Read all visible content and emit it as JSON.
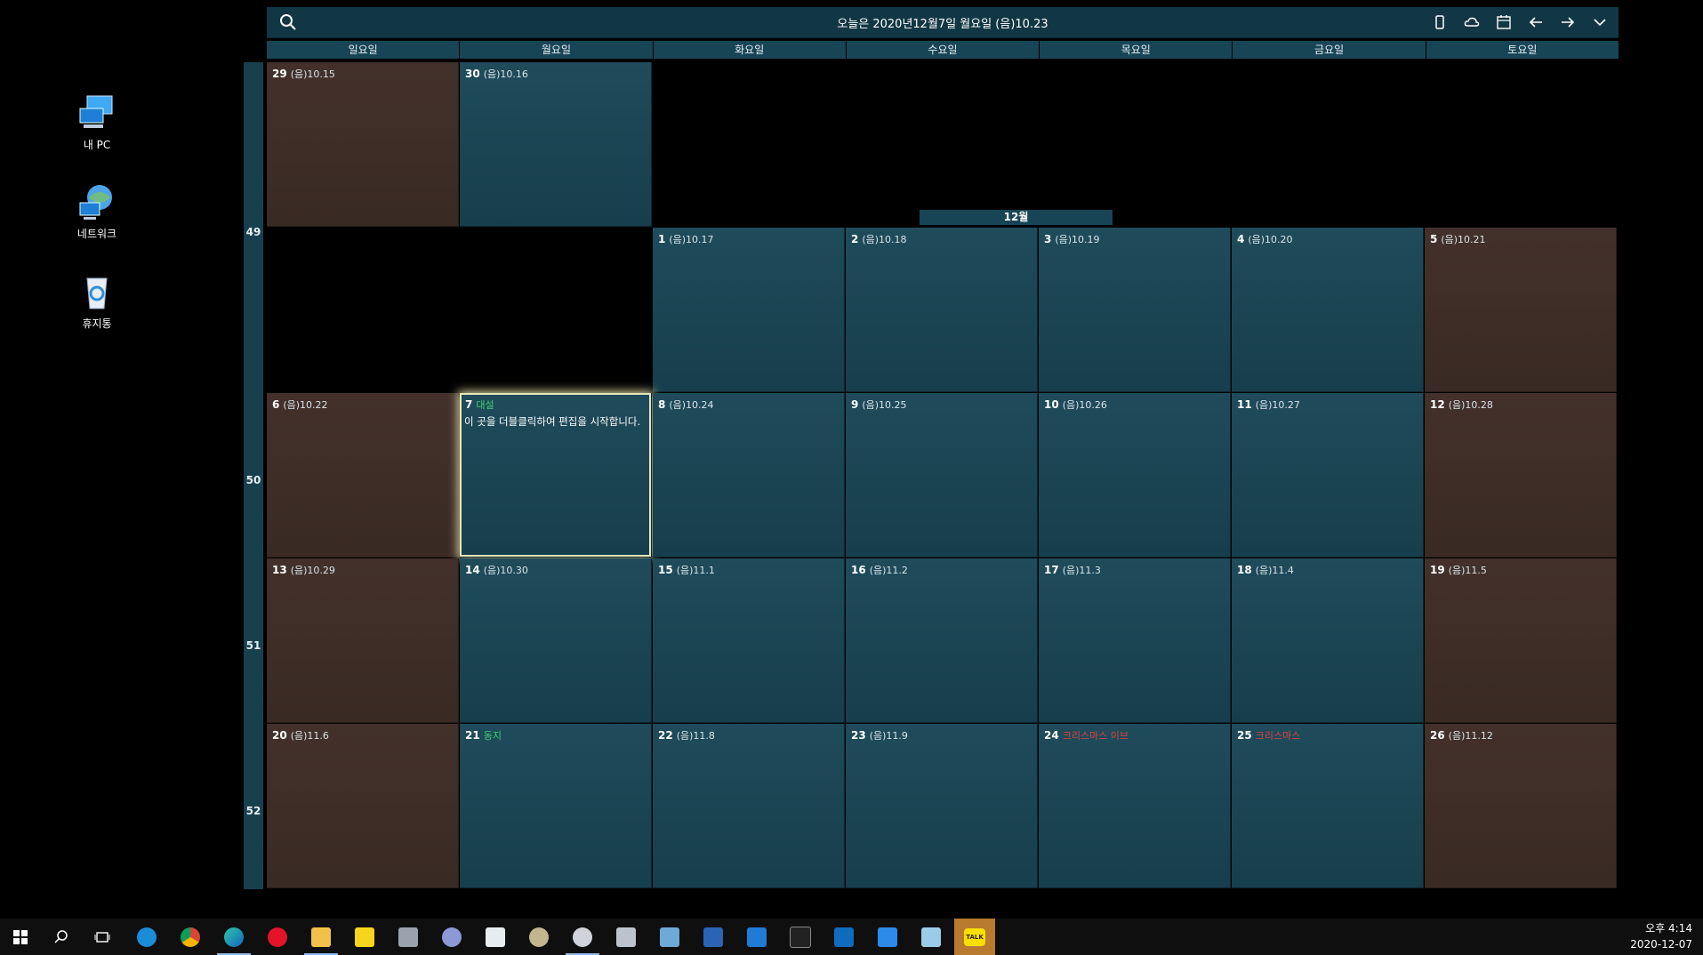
{
  "desktop": {
    "icons": [
      {
        "label": "내 PC",
        "icon": "computer-icon"
      },
      {
        "label": "네트워크",
        "icon": "network-icon"
      },
      {
        "label": "휴지통",
        "icon": "recycle-bin-icon"
      }
    ]
  },
  "calendar": {
    "title": "오늘은 2020년12월7일 월요일 (음)10.23",
    "day_names": [
      "일요일",
      "월요일",
      "화요일",
      "수요일",
      "목요일",
      "금요일",
      "토요일"
    ],
    "month_label": "12월",
    "week_numbers": [
      "49",
      "50",
      "51",
      "52"
    ],
    "prev_days": [
      {
        "num": "29",
        "lunar": "(음)10.15"
      },
      {
        "num": "30",
        "lunar": "(음)10.16"
      }
    ],
    "days": [
      {
        "num": "1",
        "lunar": "(음)10.17"
      },
      {
        "num": "2",
        "lunar": "(음)10.18"
      },
      {
        "num": "3",
        "lunar": "(음)10.19"
      },
      {
        "num": "4",
        "lunar": "(음)10.20"
      },
      {
        "num": "5",
        "lunar": "(음)10.21"
      },
      {
        "num": "6",
        "lunar": "(음)10.22"
      },
      {
        "num": "7",
        "lunar": "대설",
        "memo": "이 곳을 더블클릭하여 편집을 시작합니다."
      },
      {
        "num": "8",
        "lunar": "(음)10.24"
      },
      {
        "num": "9",
        "lunar": "(음)10.25"
      },
      {
        "num": "10",
        "lunar": "(음)10.26"
      },
      {
        "num": "11",
        "lunar": "(음)10.27"
      },
      {
        "num": "12",
        "lunar": "(음)10.28"
      },
      {
        "num": "13",
        "lunar": "(음)10.29"
      },
      {
        "num": "14",
        "lunar": "(음)10.30"
      },
      {
        "num": "15",
        "lunar": "(음)11.1"
      },
      {
        "num": "16",
        "lunar": "(음)11.2"
      },
      {
        "num": "17",
        "lunar": "(음)11.3"
      },
      {
        "num": "18",
        "lunar": "(음)11.4"
      },
      {
        "num": "19",
        "lunar": "(음)11.5"
      },
      {
        "num": "20",
        "lunar": "(음)11.6"
      },
      {
        "num": "21",
        "lunar": "동지"
      },
      {
        "num": "22",
        "lunar": "(음)11.8"
      },
      {
        "num": "23",
        "lunar": "(음)11.9"
      },
      {
        "num": "24",
        "lunar": "크리스마스 이브"
      },
      {
        "num": "25",
        "lunar": "크리스마스"
      },
      {
        "num": "26",
        "lunar": "(음)11.12"
      }
    ],
    "toolbar_icons": [
      "phone-icon",
      "cloud-icon",
      "calendar-icon",
      "arrow-left-icon",
      "arrow-right-icon",
      "chevron-down-icon"
    ],
    "colors": {
      "weekday": "#1f4b5b",
      "weekend": "#43302a",
      "solar_term": "#3fce6f",
      "holiday": "#e0423e"
    }
  },
  "taskbar": {
    "apps": [
      "windows-start-icon",
      "search-icon",
      "task-view-icon",
      "ie-icon",
      "chrome-icon",
      "edge-icon",
      "opera-icon",
      "file-explorer-icon",
      "sticky-notes-icon",
      "app-icon",
      "app-icon",
      "store-icon",
      "app-icon",
      "app-icon",
      "calculator-icon",
      "app-icon",
      "app-icon",
      "app-icon",
      "terminal-icon",
      "outlook-icon",
      "mail-icon",
      "app-icon",
      "kakaotalk-icon"
    ],
    "kakao_label": "TALK",
    "time": "오후 4:14",
    "date": "2020-12-07"
  }
}
